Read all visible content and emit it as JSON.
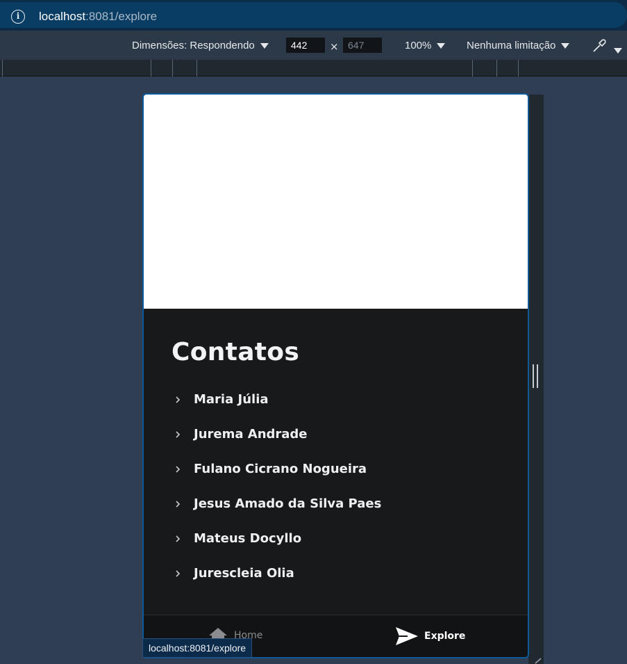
{
  "browser": {
    "url_host": "localhost",
    "url_rest": ":8081/explore",
    "info_icon": "info-icon"
  },
  "devtools": {
    "dimensions_label": "Dimensões: Respondendo",
    "width": "442",
    "height": "647",
    "zoom": "100%",
    "throttling": "Nenhuma limitação",
    "picker_icon": "eyedropper-icon"
  },
  "app": {
    "heading": "Contatos",
    "contacts": [
      {
        "name": "Maria Júlia"
      },
      {
        "name": "Jurema Andrade"
      },
      {
        "name": "Fulano Cicrano Nogueira"
      },
      {
        "name": "Jesus Amado da Silva Paes"
      },
      {
        "name": "Mateus Docyllo"
      },
      {
        "name": "Jurescleia Olia"
      }
    ],
    "nav": {
      "home_label": "Home",
      "explore_label": "Explore",
      "home_icon": "home-icon",
      "explore_icon": "send-icon"
    }
  },
  "status_bar": {
    "url": "localhost:8081/explore"
  },
  "colors": {
    "page_bg": "#2f3e52",
    "app_bg": "#18191b",
    "accent_border": "#0c5a9a"
  }
}
